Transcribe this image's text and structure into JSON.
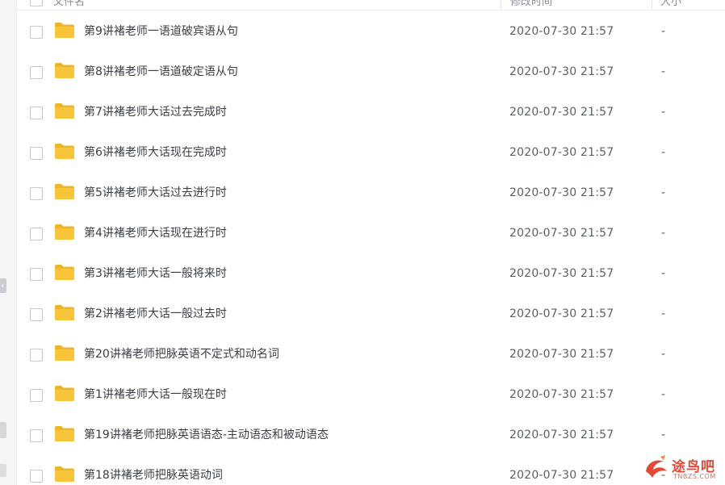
{
  "header": {
    "columns": [
      "文件名",
      "修改时间",
      "大小"
    ]
  },
  "rows": [
    {
      "name": "第9讲褚老师一语道破宾语从句",
      "modified": "2020-07-30 21:57",
      "size": "-"
    },
    {
      "name": "第8讲褚老师一语道破定语从句",
      "modified": "2020-07-30 21:57",
      "size": "-"
    },
    {
      "name": "第7讲褚老师大话过去完成时",
      "modified": "2020-07-30 21:57",
      "size": "-"
    },
    {
      "name": "第6讲褚老师大话现在完成时",
      "modified": "2020-07-30 21:57",
      "size": "-"
    },
    {
      "name": "第5讲褚老师大话过去进行时",
      "modified": "2020-07-30 21:57",
      "size": "-"
    },
    {
      "name": "第4讲褚老师大话现在进行时",
      "modified": "2020-07-30 21:57",
      "size": "-"
    },
    {
      "name": "第3讲褚老师大话一般将来时",
      "modified": "2020-07-30 21:57",
      "size": "-"
    },
    {
      "name": "第2讲褚老师大话一般过去时",
      "modified": "2020-07-30 21:57",
      "size": "-"
    },
    {
      "name": "第20讲褚老师把脉英语不定式和动名词",
      "modified": "2020-07-30 21:57",
      "size": "-"
    },
    {
      "name": "第1讲褚老师大话一般现在时",
      "modified": "2020-07-30 21:57",
      "size": "-"
    },
    {
      "name": "第19讲褚老师把脉英语语态-主动语态和被动语态",
      "modified": "2020-07-30 21:57",
      "size": "-"
    },
    {
      "name": "第18讲褚老师把脉英语动词",
      "modified": "2020-07-30 21:57",
      "size": "-"
    }
  ],
  "icons": {
    "folder": "folder-icon",
    "collapse": "chevron-left-icon"
  },
  "colors": {
    "folder": "#f8c43a",
    "folder_dark": "#eeb42a",
    "text": "#3a3f47",
    "muted": "#5a6069",
    "watermark": "#e14a36"
  },
  "watermark": {
    "text": "途鸟吧",
    "sub": "TNBZS.COM"
  }
}
